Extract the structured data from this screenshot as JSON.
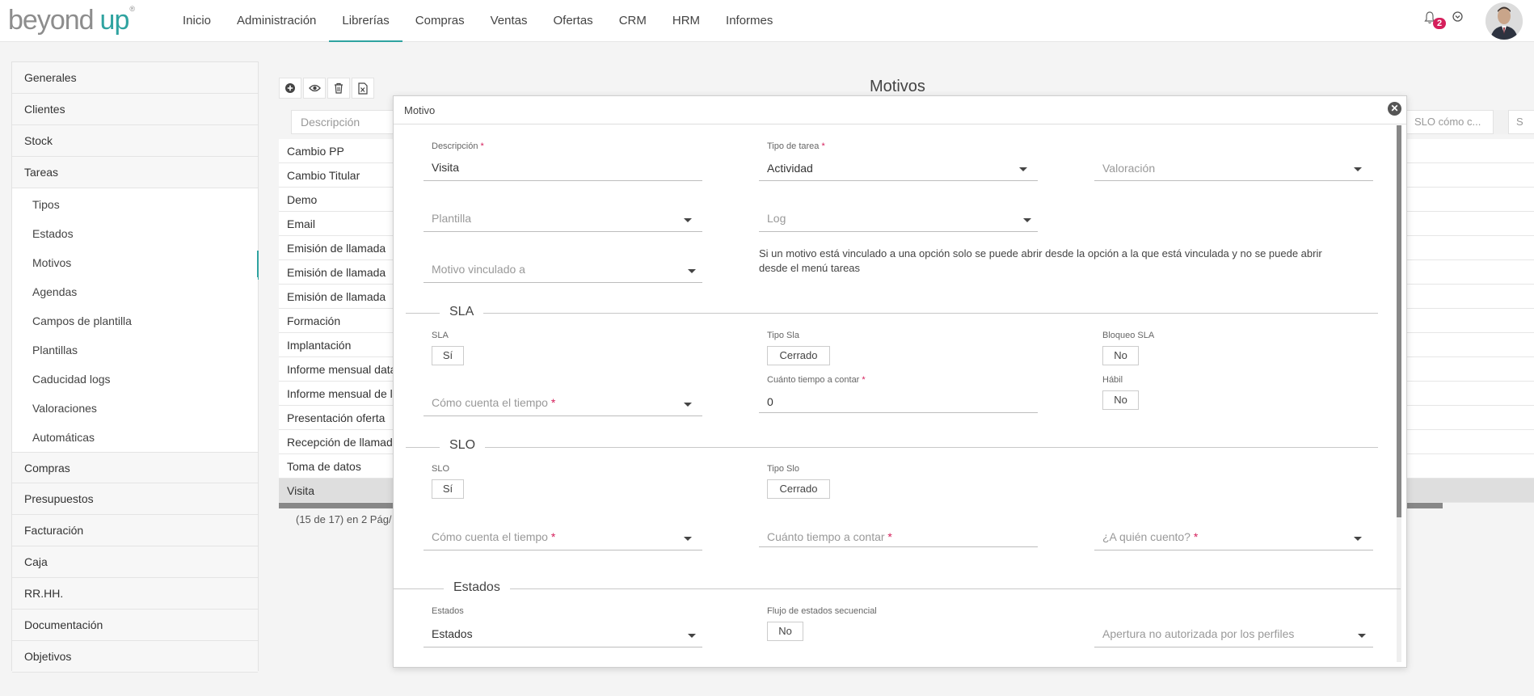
{
  "header": {
    "logo_beyond": "beyond",
    "logo_up": "up",
    "logo_reg": "®",
    "nav": [
      "Inicio",
      "Administración",
      "Librerías",
      "Compras",
      "Ventas",
      "Ofertas",
      "CRM",
      "HRM",
      "Informes"
    ],
    "active_nav": "Librerías",
    "notification_count": "2",
    "accent_color": "#2fa3a0",
    "badge_color": "#d51f5b"
  },
  "sidebar": {
    "groups_top": [
      "Generales",
      "Clientes",
      "Stock",
      "Tareas"
    ],
    "tareas_sub": [
      "Tipos",
      "Estados",
      "Motivos",
      "Agendas",
      "Campos de plantilla",
      "Plantillas",
      "Caducidad logs",
      "Valoraciones",
      "Automáticas"
    ],
    "active_sub": "Motivos",
    "groups_bottom": [
      "Compras",
      "Presupuestos",
      "Facturación",
      "Caja",
      "RR.HH.",
      "Documentación",
      "Objetivos"
    ]
  },
  "main": {
    "title": "Motivos",
    "filter_descripcion": "Descripción",
    "filter_slo": "SLO cómo c...",
    "filter_slo2": "S",
    "rows": [
      "Cambio PP",
      "Cambio Titular",
      "Demo",
      "Email",
      "Emisión de llamada",
      "Emisión de llamada",
      "Emisión de llamada",
      "Formación",
      "Implantación",
      "Informe mensual data",
      "Informe mensual de lin",
      "Presentación oferta",
      "Recepción de llamada",
      "Toma de datos",
      "Visita"
    ],
    "selected_row": "Visita",
    "paging": "(15 de 17) en 2 Pág/"
  },
  "modal": {
    "title": "Motivo",
    "close_symbol": "✕",
    "descripcion_label": "Descripción",
    "descripcion_value": "Visita",
    "tipo_tarea_label": "Tipo de tarea",
    "tipo_tarea_value": "Actividad",
    "valoracion_ph": "Valoración",
    "plantilla_ph": "Plantilla",
    "log_ph": "Log",
    "motivo_vinculado_ph": "Motivo vinculado a",
    "note_line1": "Si un motivo está vinculado a una opción solo se puede abrir desde la opción a la que está vinculada y no se puede abrir",
    "note_line2": "desde el menú tareas",
    "required_mark": "*",
    "sla": {
      "section": "SLA",
      "sla_label": "SLA",
      "sla_value": "Sí",
      "tipo_label": "Tipo Sla",
      "tipo_value": "Cerrado",
      "bloqueo_label": "Bloqueo SLA",
      "bloqueo_value": "No",
      "como_ph": "Cómo cuenta el tiempo",
      "cuanto_label": "Cuánto tiempo a contar",
      "cuanto_value": "0",
      "habil_label": "Hábil",
      "habil_value": "No"
    },
    "slo": {
      "section": "SLO",
      "slo_label": "SLO",
      "slo_value": "Sí",
      "tipo_label": "Tipo Slo",
      "tipo_value": "Cerrado",
      "como_ph": "Cómo cuenta el tiempo",
      "cuanto_ph": "Cuánto tiempo a contar",
      "quien_ph": "¿A quién cuento?"
    },
    "estados": {
      "section": "Estados",
      "estados_label": "Estados",
      "estados_value": "Estados",
      "flujo_label": "Flujo de estados secuencial",
      "flujo_value": "No",
      "apertura_ph": "Apertura no autorizada por los perfiles"
    }
  }
}
